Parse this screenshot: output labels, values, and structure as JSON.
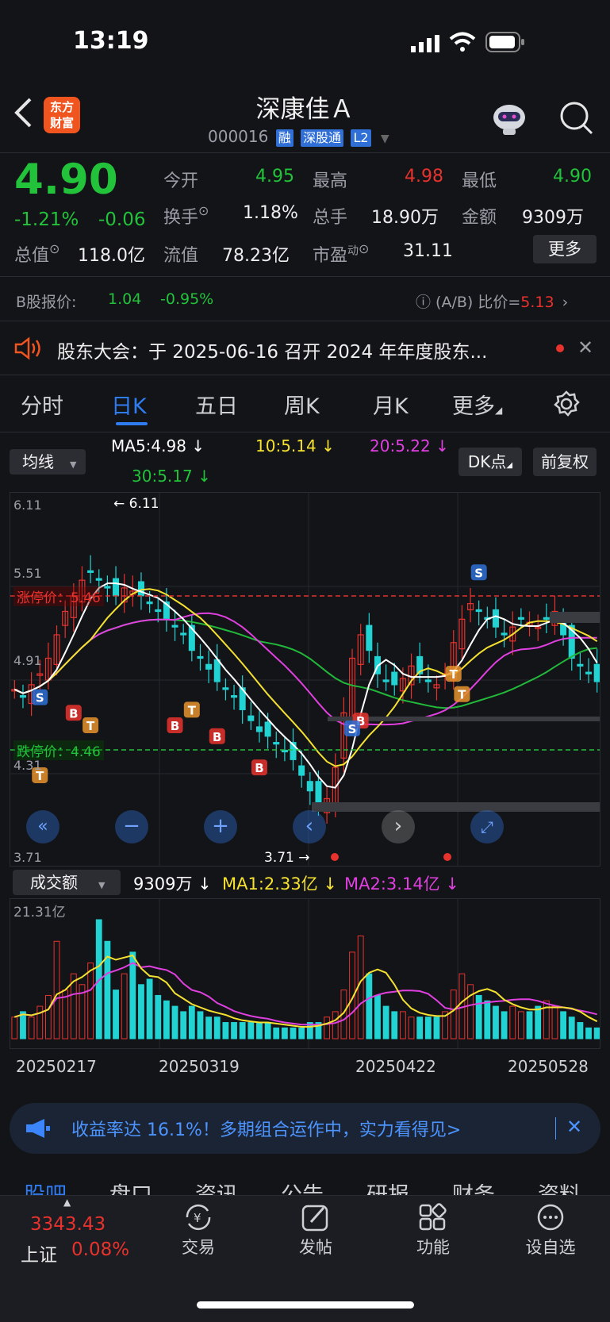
{
  "status_bar": {
    "time": "13:19"
  },
  "header": {
    "logo_line1": "东方",
    "logo_line2": "财富",
    "title": "深康佳Ａ",
    "code": "000016",
    "tags": [
      "融",
      "深股通",
      "L2"
    ]
  },
  "quote": {
    "price": "4.90",
    "change_pct": "-1.21%",
    "change": "-0.06",
    "open_label": "今开",
    "open": "4.95",
    "high_label": "最高",
    "high": "4.98",
    "low_label": "最低",
    "low": "4.90",
    "turnover_label": "换手",
    "turnover": "1.18%",
    "volume_label": "总手",
    "volume": "18.90万",
    "amount_label": "金额",
    "amount": "9309万",
    "mcap_label": "总值",
    "mcap": "118.0亿",
    "float_label": "流值",
    "float_cap": "78.23亿",
    "pe_label": "市盈",
    "pe_sup": "动",
    "pe": "31.11",
    "more_button": "更多"
  },
  "b_share": {
    "label": "B股报价:",
    "price": "1.04",
    "change": "-0.95%",
    "ratio_label": "(A/B) 比价=",
    "ratio": "5.13"
  },
  "notice": {
    "text": "股东大会：于 2025-06-16 召开 2024 年年度股东..."
  },
  "period_tabs": [
    "分时",
    "日K",
    "五日",
    "周K",
    "月K",
    "更多"
  ],
  "active_tab": "日K",
  "chart_controls": {
    "indicator": "均线",
    "ma5": "MA5:4.98",
    "ma10": "10:5.14",
    "ma20": "20:5.22",
    "ma30": "30:5.17",
    "dk_button": "DK点",
    "adjust_button": "前复权"
  },
  "chart_labels": {
    "y_top": "6.11",
    "y_mid1": "5.51",
    "y_mid2": "4.91",
    "y_mid3": "4.31",
    "y_bottom": "3.71",
    "high_marker": "6.11",
    "low_marker": "3.71",
    "limit_up": "涨停价：5.46",
    "limit_down": "跌停价：4.46"
  },
  "volume_controls": {
    "indicator": "成交额",
    "current": "9309万",
    "ma1": "MA1:2.33亿",
    "ma2": "MA2:3.14亿",
    "y_top": "21.31亿"
  },
  "date_labels": [
    "20250217",
    "20250319",
    "20250422",
    "20250528"
  ],
  "banner": {
    "text": "收益率达 16.1%！多期组合运作中，实力看得见>"
  },
  "sub_tabs": [
    "股吧",
    "盘口",
    "资讯",
    "公告",
    "研报",
    "财务",
    "资料"
  ],
  "bottom_nav": {
    "index_value": "3343.43",
    "index_name": "上证",
    "index_change": "0.08%",
    "items": [
      "交易",
      "发帖",
      "功能",
      "设自选"
    ]
  },
  "colors": {
    "up": "#e8322d",
    "down": "#22c23a",
    "accent": "#2f7bf0",
    "ma5": "#ffffff",
    "ma10": "#f5e130",
    "ma20": "#e040e0",
    "ma30": "#22b83a"
  },
  "chart_data": {
    "type": "candlestick",
    "ylim": [
      3.71,
      6.11
    ],
    "limit_up": 5.46,
    "limit_down": 4.46,
    "series": [
      {
        "name": "MA5",
        "values": [
          4.98
        ]
      },
      {
        "name": "MA10",
        "values": [
          5.14
        ]
      },
      {
        "name": "MA20",
        "values": [
          5.22
        ]
      },
      {
        "name": "MA30",
        "values": [
          5.17
        ]
      }
    ]
  }
}
